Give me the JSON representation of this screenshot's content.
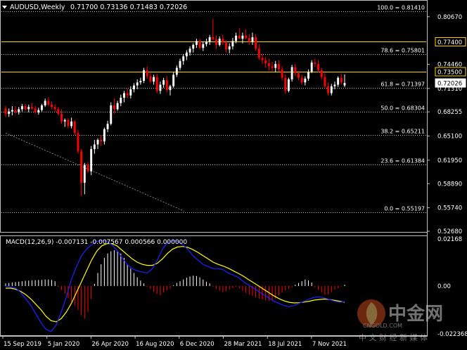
{
  "header": {
    "symbol": "AUDUSD,Weekly",
    "ohlc": "0.71700 0.73136 0.71483 0.72026",
    "menu_icon": "triangle-down-icon"
  },
  "macd": {
    "label": "MACD(12,26,9) -0.007131 -0.007567 0.000566 0.000000",
    "scale": [
      "0.02168",
      "0.00",
      "-0.022368"
    ]
  },
  "watermark": {
    "brand": "中金网",
    "domain": "CNGOLD.COM",
    "slogan": "中 文 财 经 新 媒 体"
  },
  "colors": {
    "background": "#000000",
    "bull": "#ffffff",
    "bear": "#ff0000",
    "level_line": "#ffd700",
    "macd_signal": "#ffff00",
    "macd_main": "#2020ff",
    "grid": "#ffffff"
  },
  "chart_data": {
    "type": "candlestick",
    "title": "AUDUSD,Weekly",
    "x_labels": [
      "15 Sep 2019",
      "5 Jan 2020",
      "26 Apr 2020",
      "16 Aug 2020",
      "6 Dec 2020",
      "28 Mar 2021",
      "18 Jul 2021",
      "7 Nov 2021"
    ],
    "price_ticks": [
      "0.80670",
      "0.74460",
      "0.71310",
      "0.68255",
      "0.65100",
      "0.61950",
      "0.58890",
      "0.55740",
      "0.52680"
    ],
    "ylim": [
      0.5268,
      0.8267
    ],
    "highlighted_prices": [
      {
        "label": "0.77400",
        "value": 0.774,
        "style": "boxed-black"
      },
      {
        "label": "0.73500",
        "value": 0.735,
        "style": "boxed-black"
      },
      {
        "label": "0.72026",
        "value": 0.72026,
        "style": "boxed-white"
      }
    ],
    "fibonacci_levels": [
      {
        "label": "100.0 = 0.81410",
        "value": 0.8141
      },
      {
        "label": "78.6 = 0.75801",
        "value": 0.75801
      },
      {
        "label": "61.8 = 0.71397",
        "value": 0.71397
      },
      {
        "label": "50.0 = 0.68304",
        "value": 0.68304
      },
      {
        "label": "38.2 = 0.65211",
        "value": 0.65211
      },
      {
        "label": "23.6 = 0.61384",
        "value": 0.61384
      },
      {
        "label": "0.0 = 0.55197",
        "value": 0.55197
      }
    ],
    "ohlc": [
      [
        0.687,
        0.69,
        0.676,
        0.68
      ],
      [
        0.68,
        0.687,
        0.676,
        0.683
      ],
      [
        0.683,
        0.69,
        0.678,
        0.685
      ],
      [
        0.685,
        0.69,
        0.68,
        0.682
      ],
      [
        0.682,
        0.689,
        0.679,
        0.686
      ],
      [
        0.686,
        0.693,
        0.683,
        0.69
      ],
      [
        0.69,
        0.693,
        0.684,
        0.686
      ],
      [
        0.686,
        0.692,
        0.682,
        0.689
      ],
      [
        0.689,
        0.694,
        0.685,
        0.687
      ],
      [
        0.687,
        0.69,
        0.68,
        0.682
      ],
      [
        0.682,
        0.688,
        0.679,
        0.685
      ],
      [
        0.685,
        0.693,
        0.683,
        0.691
      ],
      [
        0.691,
        0.7,
        0.689,
        0.697
      ],
      [
        0.697,
        0.701,
        0.69,
        0.692
      ],
      [
        0.692,
        0.696,
        0.686,
        0.689
      ],
      [
        0.689,
        0.692,
        0.683,
        0.686
      ],
      [
        0.686,
        0.689,
        0.678,
        0.68
      ],
      [
        0.68,
        0.686,
        0.667,
        0.67
      ],
      [
        0.67,
        0.674,
        0.663,
        0.672
      ],
      [
        0.672,
        0.674,
        0.661,
        0.664
      ],
      [
        0.664,
        0.675,
        0.661,
        0.67
      ],
      [
        0.67,
        0.672,
        0.652,
        0.655
      ],
      [
        0.655,
        0.659,
        0.628,
        0.631
      ],
      [
        0.631,
        0.634,
        0.573,
        0.59
      ],
      [
        0.59,
        0.616,
        0.575,
        0.613
      ],
      [
        0.613,
        0.617,
        0.603,
        0.605
      ],
      [
        0.605,
        0.638,
        0.6,
        0.634
      ],
      [
        0.634,
        0.646,
        0.628,
        0.64
      ],
      [
        0.64,
        0.648,
        0.634,
        0.646
      ],
      [
        0.646,
        0.652,
        0.638,
        0.644
      ],
      [
        0.644,
        0.662,
        0.64,
        0.66
      ],
      [
        0.66,
        0.671,
        0.656,
        0.667
      ],
      [
        0.667,
        0.695,
        0.665,
        0.691
      ],
      [
        0.691,
        0.7,
        0.68,
        0.686
      ],
      [
        0.686,
        0.697,
        0.684,
        0.694
      ],
      [
        0.694,
        0.705,
        0.69,
        0.701
      ],
      [
        0.701,
        0.71,
        0.695,
        0.707
      ],
      [
        0.707,
        0.713,
        0.7,
        0.704
      ],
      [
        0.704,
        0.716,
        0.7,
        0.712
      ],
      [
        0.712,
        0.72,
        0.708,
        0.717
      ],
      [
        0.717,
        0.725,
        0.712,
        0.721
      ],
      [
        0.721,
        0.727,
        0.718,
        0.723
      ],
      [
        0.723,
        0.74,
        0.72,
        0.737
      ],
      [
        0.737,
        0.742,
        0.726,
        0.729
      ],
      [
        0.729,
        0.733,
        0.72,
        0.722
      ],
      [
        0.722,
        0.731,
        0.718,
        0.728
      ],
      [
        0.728,
        0.732,
        0.707,
        0.71
      ],
      [
        0.71,
        0.722,
        0.706,
        0.718
      ],
      [
        0.718,
        0.727,
        0.714,
        0.724
      ],
      [
        0.724,
        0.729,
        0.708,
        0.711
      ],
      [
        0.711,
        0.718,
        0.704,
        0.716
      ],
      [
        0.716,
        0.734,
        0.714,
        0.731
      ],
      [
        0.731,
        0.743,
        0.728,
        0.74
      ],
      [
        0.74,
        0.752,
        0.737,
        0.749
      ],
      [
        0.749,
        0.758,
        0.744,
        0.755
      ],
      [
        0.755,
        0.763,
        0.75,
        0.76
      ],
      [
        0.76,
        0.768,
        0.756,
        0.765
      ],
      [
        0.765,
        0.772,
        0.76,
        0.77
      ],
      [
        0.77,
        0.778,
        0.766,
        0.775
      ],
      [
        0.775,
        0.778,
        0.764,
        0.766
      ],
      [
        0.766,
        0.774,
        0.762,
        0.771
      ],
      [
        0.771,
        0.778,
        0.768,
        0.774
      ],
      [
        0.774,
        0.783,
        0.77,
        0.78
      ],
      [
        0.78,
        0.804,
        0.776,
        0.777
      ],
      [
        0.777,
        0.782,
        0.765,
        0.77
      ],
      [
        0.77,
        0.781,
        0.768,
        0.778
      ],
      [
        0.778,
        0.783,
        0.77,
        0.773
      ],
      [
        0.773,
        0.776,
        0.76,
        0.764
      ],
      [
        0.764,
        0.772,
        0.759,
        0.768
      ],
      [
        0.768,
        0.779,
        0.764,
        0.775
      ],
      [
        0.775,
        0.786,
        0.772,
        0.782
      ],
      [
        0.782,
        0.792,
        0.778,
        0.778
      ],
      [
        0.778,
        0.786,
        0.772,
        0.782
      ],
      [
        0.782,
        0.79,
        0.777,
        0.779
      ],
      [
        0.779,
        0.784,
        0.77,
        0.774
      ],
      [
        0.774,
        0.786,
        0.77,
        0.78
      ],
      [
        0.78,
        0.784,
        0.762,
        0.765
      ],
      [
        0.765,
        0.771,
        0.75,
        0.753
      ],
      [
        0.753,
        0.758,
        0.745,
        0.75
      ],
      [
        0.75,
        0.754,
        0.74,
        0.746
      ],
      [
        0.746,
        0.752,
        0.736,
        0.742
      ],
      [
        0.742,
        0.748,
        0.736,
        0.74
      ],
      [
        0.74,
        0.749,
        0.734,
        0.745
      ],
      [
        0.745,
        0.75,
        0.735,
        0.738
      ],
      [
        0.738,
        0.742,
        0.724,
        0.727
      ],
      [
        0.727,
        0.731,
        0.706,
        0.71
      ],
      [
        0.71,
        0.727,
        0.708,
        0.725
      ],
      [
        0.725,
        0.744,
        0.722,
        0.741
      ],
      [
        0.741,
        0.745,
        0.729,
        0.733
      ],
      [
        0.733,
        0.736,
        0.724,
        0.727
      ],
      [
        0.727,
        0.731,
        0.718,
        0.721
      ],
      [
        0.721,
        0.729,
        0.717,
        0.726
      ],
      [
        0.726,
        0.738,
        0.723,
        0.735
      ],
      [
        0.735,
        0.75,
        0.733,
        0.747
      ],
      [
        0.747,
        0.752,
        0.741,
        0.745
      ],
      [
        0.745,
        0.75,
        0.734,
        0.737
      ],
      [
        0.737,
        0.74,
        0.725,
        0.728
      ],
      [
        0.728,
        0.733,
        0.713,
        0.716
      ],
      [
        0.716,
        0.721,
        0.704,
        0.707
      ],
      [
        0.707,
        0.719,
        0.704,
        0.716
      ],
      [
        0.716,
        0.722,
        0.712,
        0.718
      ],
      [
        0.718,
        0.729,
        0.715,
        0.727
      ],
      [
        0.727,
        0.732,
        0.718,
        0.721
      ],
      [
        0.717,
        0.73136,
        0.71483,
        0.72026
      ]
    ],
    "trendline": {
      "from_index": 0,
      "from_value": 0.655,
      "to_index": 50,
      "to_value": 0.553,
      "style": "dotted-grey"
    },
    "macd_histogram": [
      0.0012,
      0.0014,
      0.0016,
      0.0018,
      0.002,
      0.0022,
      0.0024,
      0.0025,
      0.0026,
      0.0027,
      0.0028,
      0.0028,
      0.003,
      0.003,
      0.0028,
      0.0022,
      -0.0004,
      -0.0018,
      -0.0035,
      -0.0055,
      -0.0072,
      -0.009,
      -0.011,
      -0.0135,
      -0.015,
      -0.012,
      -0.006,
      0.001,
      0.006,
      0.01,
      0.013,
      0.015,
      0.016,
      0.0165,
      0.016,
      0.015,
      0.013,
      0.01,
      0.008,
      0.006,
      0.004,
      0.0025,
      0.0012,
      -0.0004,
      -0.0014,
      -0.0026,
      -0.0036,
      -0.0042,
      -0.003,
      -0.002,
      -0.0012,
      0.0004,
      0.0014,
      0.0022,
      0.003,
      0.0038,
      0.0044,
      0.0048,
      0.0046,
      0.004,
      0.003,
      0.002,
      0.0012,
      -0.0004,
      -0.0014,
      -0.0022,
      -0.0028,
      -0.0024,
      -0.0016,
      -0.001,
      -0.0004,
      -0.0012,
      -0.0022,
      -0.0032,
      -0.004,
      -0.0046,
      -0.0052,
      -0.0058,
      -0.0062,
      -0.0066,
      -0.0068,
      -0.0066,
      -0.0058,
      -0.0044,
      -0.003,
      -0.002,
      -0.0014,
      -0.0006,
      0.0006,
      0.0014,
      0.0022,
      0.003,
      0.0026,
      0.0016,
      -0.0006,
      -0.0018,
      -0.003,
      -0.004,
      -0.0038,
      -0.0028,
      -0.0016,
      -0.001,
      -0.0002,
      0.0006
    ],
    "macd_main": [
      0.0,
      -0.0004,
      -0.001,
      -0.003,
      -0.006,
      -0.009,
      -0.013,
      -0.017,
      -0.02,
      -0.021,
      -0.018,
      -0.012,
      -0.005,
      0.003,
      0.009,
      0.014,
      0.017,
      0.019,
      0.0205,
      0.021,
      0.0205,
      0.019,
      0.0165,
      0.013,
      0.01,
      0.008,
      0.007,
      0.0065,
      0.006,
      0.008,
      0.012,
      0.017,
      0.02,
      0.021,
      0.0205,
      0.019,
      0.017,
      0.014,
      0.012,
      0.01,
      0.009,
      0.008,
      0.008,
      0.0075,
      0.006,
      0.005,
      0.004,
      0.002,
      0.0005,
      -0.001,
      -0.0025,
      -0.004,
      -0.0055,
      -0.007,
      -0.008,
      -0.009,
      -0.0095,
      -0.009,
      -0.008,
      -0.007,
      -0.006,
      -0.0052,
      -0.005,
      -0.0055,
      -0.0062,
      -0.007,
      -0.0075,
      -0.0072
    ],
    "macd_signal": [
      -0.001,
      -0.001,
      -0.0015,
      -0.0025,
      -0.004,
      -0.006,
      -0.0085,
      -0.011,
      -0.014,
      -0.016,
      -0.0165,
      -0.015,
      -0.012,
      -0.008,
      -0.003,
      0.002,
      0.007,
      0.012,
      0.016,
      0.0185,
      0.0195,
      0.0195,
      0.0185,
      0.0165,
      0.0145,
      0.0125,
      0.011,
      0.01,
      0.0095,
      0.0095,
      0.0105,
      0.0125,
      0.015,
      0.017,
      0.018,
      0.0182,
      0.0178,
      0.0168,
      0.0155,
      0.014,
      0.0125,
      0.011,
      0.01,
      0.0092,
      0.0082,
      0.007,
      0.0058,
      0.0045,
      0.003,
      0.0015,
      0.0,
      -0.0015,
      -0.003,
      -0.0045,
      -0.0058,
      -0.0068,
      -0.0075,
      -0.0078,
      -0.0077,
      -0.0074,
      -0.007,
      -0.0065,
      -0.0062,
      -0.006,
      -0.0062,
      -0.0066,
      -0.007,
      -0.0075
    ]
  }
}
